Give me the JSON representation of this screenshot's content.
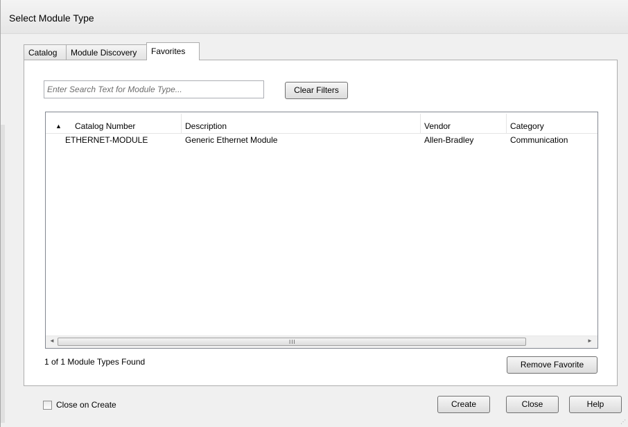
{
  "window": {
    "title": "Select Module Type"
  },
  "tabs": [
    {
      "label": "Catalog",
      "active": false
    },
    {
      "label": "Module Discovery",
      "active": false
    },
    {
      "label": "Favorites",
      "active": true
    }
  ],
  "search": {
    "placeholder": "Enter Search Text for Module Type..."
  },
  "clear_filters_label": "Clear Filters",
  "table": {
    "sort_indicator": "▲",
    "columns": [
      "Catalog Number",
      "Description",
      "Vendor",
      "Category"
    ],
    "rows": [
      [
        "ETHERNET-MODULE",
        "Generic Ethernet Module",
        "Allen-Bradley",
        "Communication"
      ]
    ]
  },
  "scrollbar": {
    "left_arrow": "◄",
    "right_arrow": "►",
    "grip": "III"
  },
  "status": {
    "found_text": "1 of 1 Module Types Found"
  },
  "remove_favorite_label": "Remove Favorite",
  "close_on_create": {
    "label": "Close on Create",
    "checked": false
  },
  "buttons": {
    "create": "Create",
    "close": "Close",
    "help": "Help"
  },
  "colors": {
    "window_bg": "#f0f0f0",
    "panel_bg": "#ffffff",
    "border": "#adadad"
  }
}
